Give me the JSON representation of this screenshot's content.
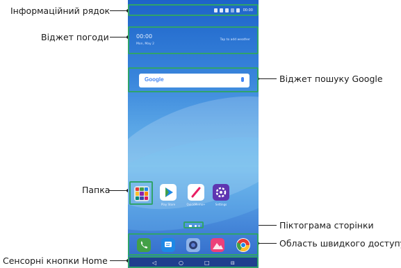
{
  "labels": {
    "status_bar": "Інформаційний рядок",
    "weather_widget": "Віджет погоди",
    "google_widget": "Віджет пошуку Google",
    "folder": "Папка",
    "page_icon": "Піктограма сторінки",
    "quick_access": "Область швидкого доступу",
    "home_keys": "Сенсорні кнопки Home"
  },
  "phone": {
    "status_time": "00:00",
    "weather_time": "00:00",
    "weather_date": "Mon, May 2",
    "weather_tap": "Tap to add weather",
    "google_logo": "Google",
    "apps": [
      "Play Store",
      "QuickMemo+",
      "Settings"
    ]
  },
  "icons": {
    "quick": [
      "phone-icon",
      "messaging-icon",
      "camera-icon",
      "gallery-icon",
      "chrome-icon"
    ],
    "home_keys": [
      "back-icon",
      "home-icon",
      "overview-icon",
      "dual-window-icon"
    ]
  },
  "colors": {
    "highlight": "#2fa36b",
    "wallpaper_top": "#1d63c9",
    "wallpaper_mid": "#6cb6ea"
  }
}
